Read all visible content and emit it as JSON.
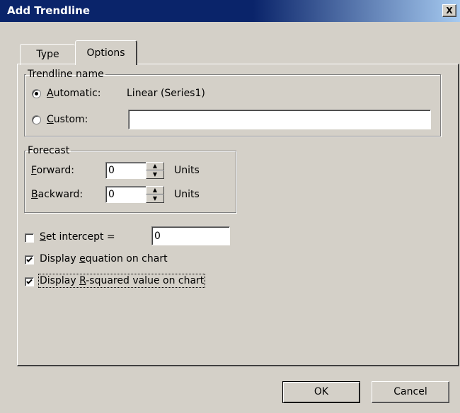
{
  "window": {
    "title": "Add Trendline",
    "close_glyph": "X"
  },
  "tabs": [
    {
      "label": "Type"
    },
    {
      "label": "Options"
    }
  ],
  "trendline_name": {
    "legend": "Trendline name",
    "automatic_label_mnemonic": "A",
    "automatic_label_rest": "utomatic:",
    "automatic_value": "Linear (Series1)",
    "automatic_selected": true,
    "custom_label_mnemonic": "C",
    "custom_label_rest": "ustom:",
    "custom_value": "",
    "custom_selected": false
  },
  "forecast": {
    "legend": "Forecast",
    "forward_mnemonic": "F",
    "forward_rest": "orward:",
    "forward_value": "0",
    "forward_units": "Units",
    "backward_mnemonic": "B",
    "backward_rest": "ackward:",
    "backward_value": "0",
    "backward_units": "Units"
  },
  "options": {
    "set_intercept_mnemonic": "S",
    "set_intercept_rest": "et intercept =",
    "set_intercept_checked": false,
    "set_intercept_value": "0",
    "display_equation_before": "Display ",
    "display_equation_mnemonic": "e",
    "display_equation_after": "quation on chart",
    "display_equation_checked": true,
    "display_r2_before": "Display ",
    "display_r2_mnemonic": "R",
    "display_r2_after": "-squared value on chart",
    "display_r2_checked": true
  },
  "buttons": {
    "ok": "OK",
    "cancel": "Cancel"
  }
}
